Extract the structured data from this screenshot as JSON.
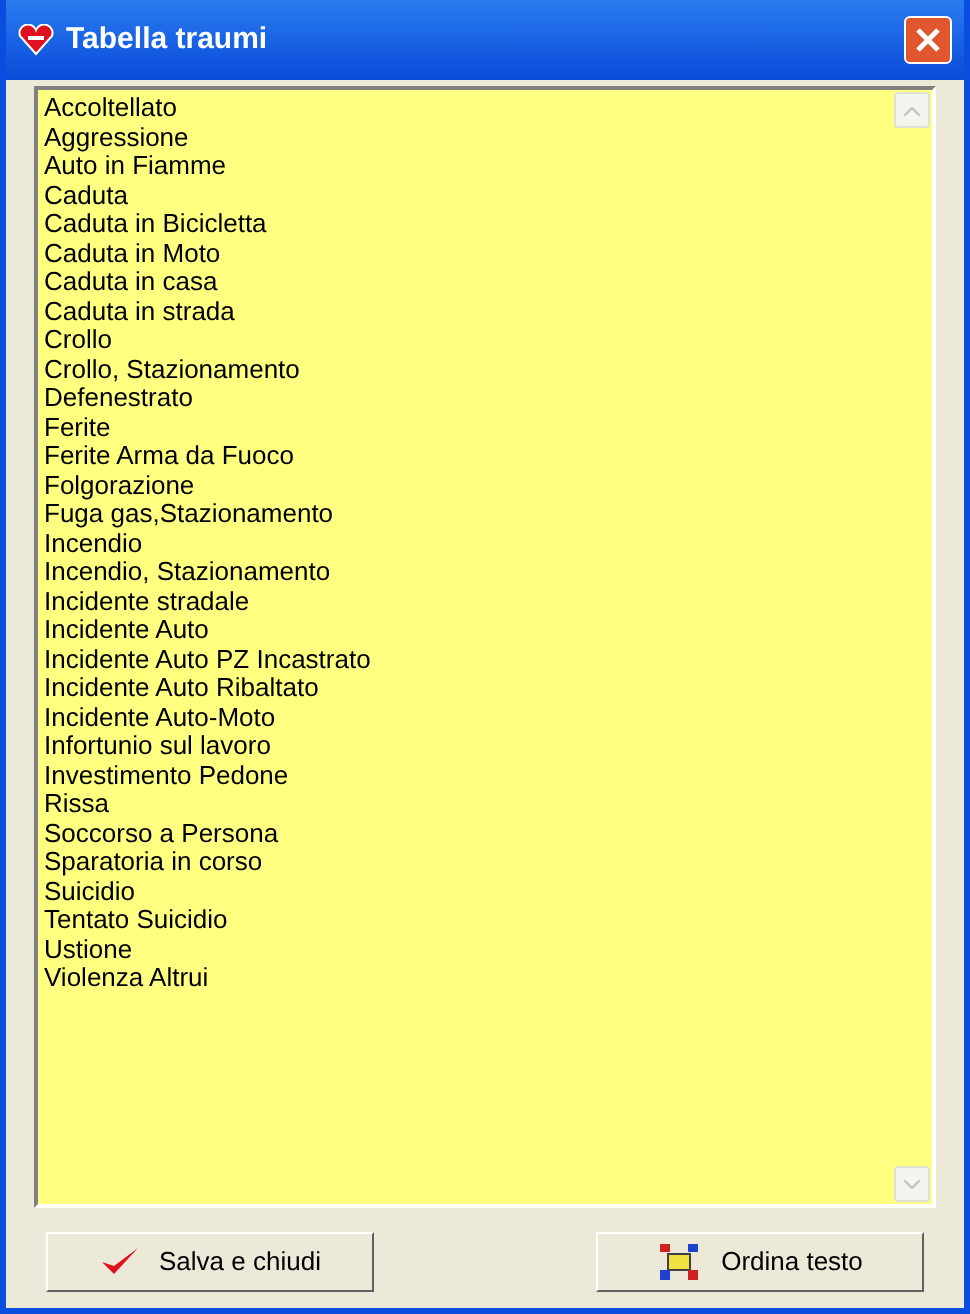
{
  "window": {
    "title": "Tabella traumi"
  },
  "lines": [
    "Accoltellato",
    "Aggressione",
    "Auto in Fiamme",
    "Caduta",
    "Caduta in Bicicletta",
    "Caduta in Moto",
    "Caduta in casa",
    "Caduta in strada",
    "Crollo",
    "Crollo, Stazionamento",
    "Defenestrato",
    "Ferite",
    "Ferite Arma da Fuoco",
    "Folgorazione",
    "Fuga gas,Stazionamento",
    "Incendio",
    "Incendio, Stazionamento",
    "Incidente stradale",
    "Incidente Auto",
    "Incidente Auto PZ Incastrato",
    "Incidente Auto Ribaltato",
    "Incidente Auto-Moto",
    "Infortunio sul lavoro",
    "Investimento Pedone",
    "Rissa",
    "Soccorso a Persona",
    "Sparatoria in corso",
    "Suicidio",
    "Tentato Suicidio",
    "Ustione",
    "Violenza Altrui"
  ],
  "buttons": [
    {
      "kind": "save",
      "label": "Salva e chiudi"
    },
    {
      "kind": "sort",
      "label": "Ordina testo"
    }
  ]
}
